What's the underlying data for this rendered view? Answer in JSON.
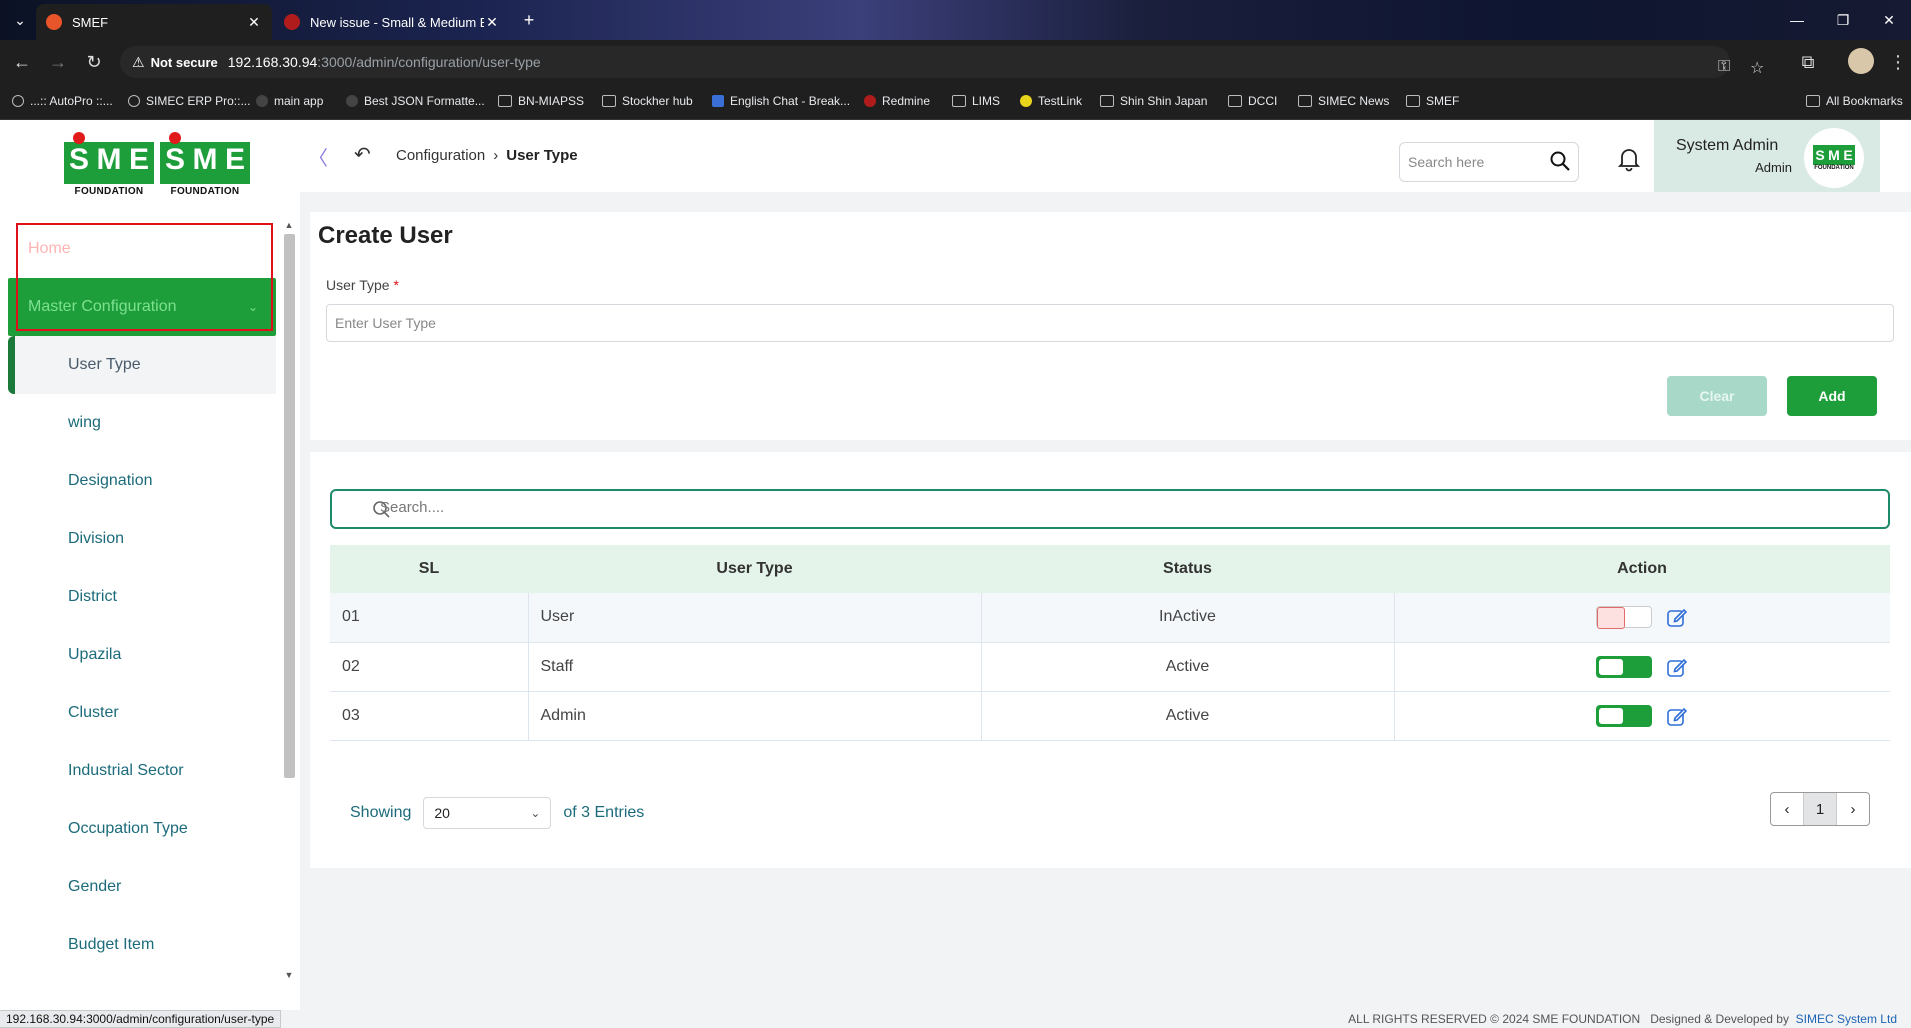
{
  "browser": {
    "tabs": [
      {
        "title": "SMEF",
        "active": true
      },
      {
        "title": "New issue - Small & Medium Ent",
        "active": false
      }
    ],
    "not_secure": "Not secure",
    "url_host": "192.168.30.94",
    "url_path": ":3000/admin/configuration/user-type",
    "bookmarks": [
      "...:: AutoPro ::...",
      "SIMEC ERP Pro::...",
      "main app",
      "Best JSON Formatte...",
      "BN-MIAPSS",
      "Stockher hub",
      "English Chat - Break...",
      "Redmine",
      "LIMS",
      "TestLink",
      "Shin Shin Japan",
      "DCCI",
      "SIMEC News",
      "SMEF"
    ],
    "all_bookmarks": "All Bookmarks",
    "status_url": "192.168.30.94:3000/admin/configuration/user-type"
  },
  "logo": {
    "mark": "SME",
    "sub": "FOUNDATION"
  },
  "sidebar": {
    "home": "Home",
    "master": "Master Configuration",
    "items": [
      "User Type",
      "wing",
      "Designation",
      "Division",
      "District",
      "Upazila",
      "Cluster",
      "Industrial Sector",
      "Occupation Type",
      "Gender",
      "Budget Item"
    ]
  },
  "topbar": {
    "breadcrumb_parent": "Configuration",
    "breadcrumb_current": "User Type",
    "search_placeholder": "Search here",
    "user_name": "System Admin",
    "user_role": "Admin"
  },
  "create_form": {
    "title": "Create User",
    "label": "User Type",
    "required_mark": "*",
    "placeholder": "Enter User Type",
    "clear_label": "Clear",
    "add_label": "Add"
  },
  "list": {
    "search_placeholder": "Search....",
    "columns": [
      "SL",
      "User Type",
      "Status",
      "Action"
    ],
    "rows": [
      {
        "sl": "01",
        "user_type": "User",
        "status": "InActive"
      },
      {
        "sl": "02",
        "user_type": "Staff",
        "status": "Active"
      },
      {
        "sl": "03",
        "user_type": "Admin",
        "status": "Active"
      }
    ],
    "showing_label": "Showing",
    "page_size": "20",
    "entries_label": "of 3 Entries",
    "current_page": "1"
  },
  "footer": {
    "rights": "ALL RIGHTS RESERVED © 2024 SME FOUNDATION",
    "designed_by": "Designed & Developed by",
    "company": "SIMEC System Ltd"
  },
  "colors": {
    "brand_green": "#1e9e3a",
    "inactive_red": "#d92b2b",
    "teal_text": "#1b6b7a"
  }
}
